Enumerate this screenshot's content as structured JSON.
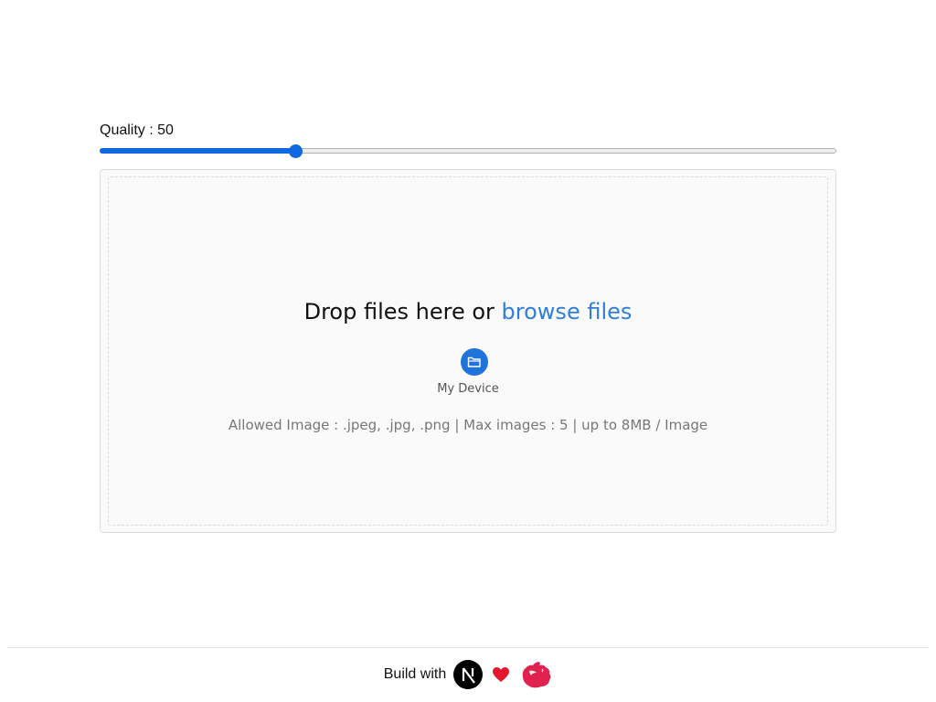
{
  "quality": {
    "label": "Quality : 50",
    "value": 50,
    "min": 0,
    "max": 100,
    "accent_color": "#0f69e0"
  },
  "dropzone": {
    "title_prefix": "Drop files here or ",
    "browse_label": "browse files",
    "browse_color": "#2f7ed8",
    "device_icon": "folder-icon",
    "device_label": "My Device",
    "allowed_text": "Allowed Image : .jpeg, .jpg, .png | Max images : 5 | up to 8MB / Image"
  },
  "footer": {
    "text": "Build with",
    "icons": [
      "nextjs-logo",
      "heart-icon",
      "nestjs-logo"
    ],
    "heart_color": "#e3172e",
    "nest_color": "#e0234e"
  }
}
